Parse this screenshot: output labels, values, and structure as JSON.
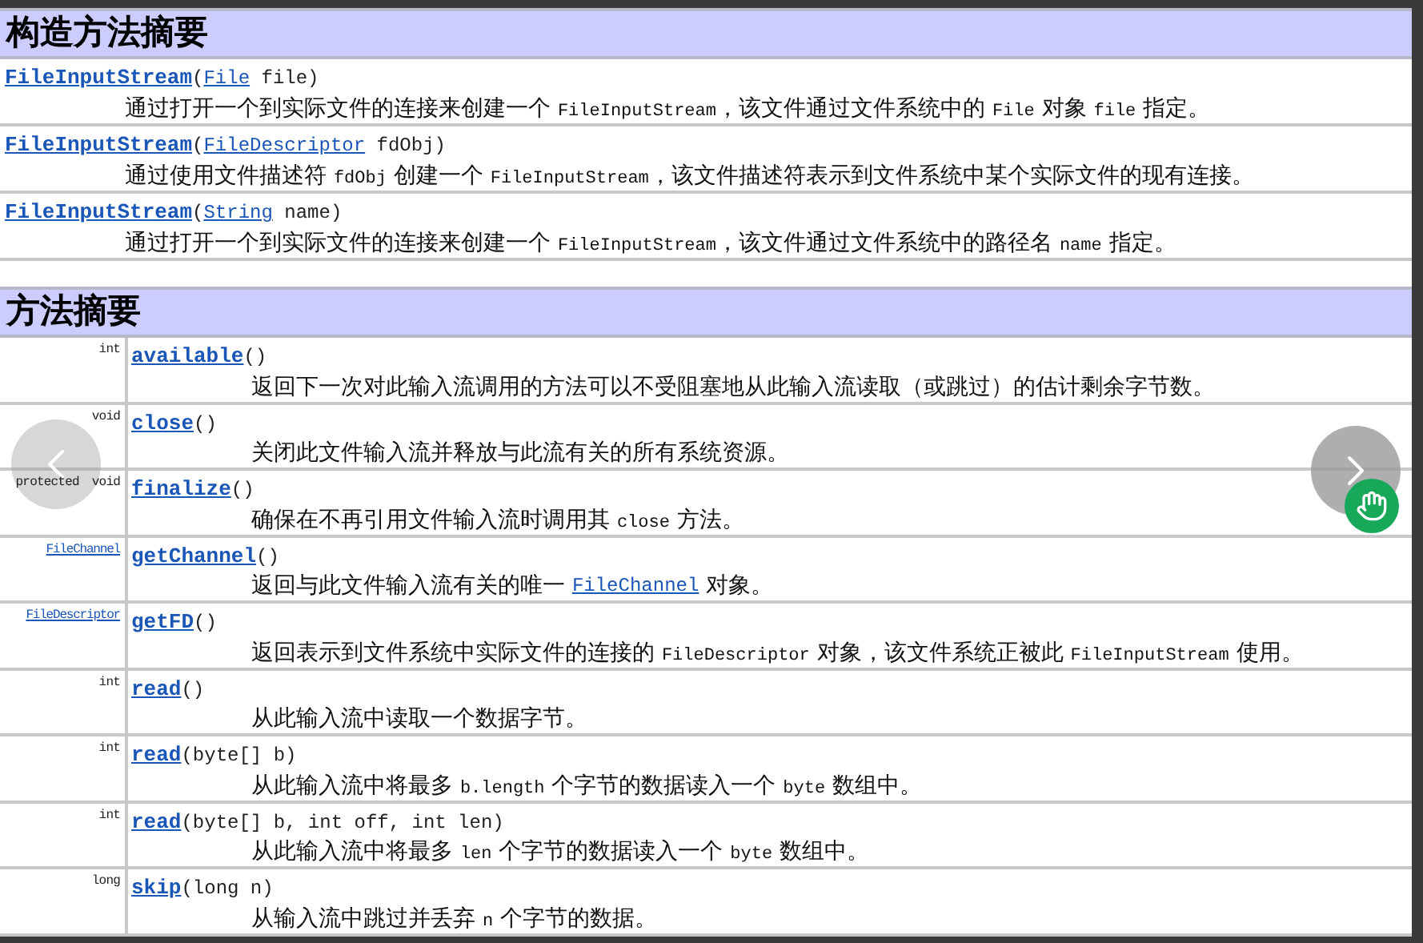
{
  "constructor_summary": {
    "title": "构造方法摘要",
    "rows": [
      {
        "signature": [
          {
            "kind": "method",
            "text": "FileInputStream"
          },
          {
            "kind": "plain",
            "text": "("
          },
          {
            "kind": "link",
            "text": "File"
          },
          {
            "kind": "plain",
            "text": " file)"
          }
        ],
        "description": [
          {
            "kind": "text",
            "text": "通过打开一个到实际文件的连接来创建一个 "
          },
          {
            "kind": "code",
            "text": "FileInputStream"
          },
          {
            "kind": "text",
            "text": "，该文件通过文件系统中的 "
          },
          {
            "kind": "code",
            "text": "File"
          },
          {
            "kind": "text",
            "text": " 对象 "
          },
          {
            "kind": "code",
            "text": "file"
          },
          {
            "kind": "text",
            "text": " 指定。"
          }
        ]
      },
      {
        "signature": [
          {
            "kind": "method",
            "text": "FileInputStream"
          },
          {
            "kind": "plain",
            "text": "("
          },
          {
            "kind": "link",
            "text": "FileDescriptor"
          },
          {
            "kind": "plain",
            "text": " fdObj)"
          }
        ],
        "description": [
          {
            "kind": "text",
            "text": "通过使用文件描述符 "
          },
          {
            "kind": "code",
            "text": "fdObj"
          },
          {
            "kind": "text",
            "text": " 创建一个 "
          },
          {
            "kind": "code",
            "text": "FileInputStream"
          },
          {
            "kind": "text",
            "text": "，该文件描述符表示到文件系统中某个实际文件的现有连接。"
          }
        ]
      },
      {
        "signature": [
          {
            "kind": "method",
            "text": "FileInputStream"
          },
          {
            "kind": "plain",
            "text": "("
          },
          {
            "kind": "link",
            "text": "String"
          },
          {
            "kind": "plain",
            "text": " name)"
          }
        ],
        "description": [
          {
            "kind": "text",
            "text": "通过打开一个到实际文件的连接来创建一个 "
          },
          {
            "kind": "code",
            "text": "FileInputStream"
          },
          {
            "kind": "text",
            "text": "，该文件通过文件系统中的路径名 "
          },
          {
            "kind": "code",
            "text": "name"
          },
          {
            "kind": "text",
            "text": " 指定。"
          }
        ]
      }
    ]
  },
  "method_summary": {
    "title": "方法摘要",
    "rows": [
      {
        "modifiers": [
          {
            "kind": "plain",
            "text": "int"
          }
        ],
        "signature": [
          {
            "kind": "method",
            "text": "available"
          },
          {
            "kind": "plain",
            "text": "()"
          }
        ],
        "description": [
          {
            "kind": "text",
            "text": "返回下一次对此输入流调用的方法可以不受阻塞地从此输入流读取（或跳过）的估计剩余字节数。"
          }
        ]
      },
      {
        "modifiers": [
          {
            "kind": "plain",
            "text": "void"
          }
        ],
        "signature": [
          {
            "kind": "method",
            "text": "close"
          },
          {
            "kind": "plain",
            "text": "()"
          }
        ],
        "description": [
          {
            "kind": "text",
            "text": "关闭此文件输入流并释放与此流有关的所有系统资源。"
          }
        ]
      },
      {
        "modifiers": [
          {
            "kind": "plain",
            "text": "protected"
          },
          {
            "kind": "plain",
            "text": "void"
          }
        ],
        "signature": [
          {
            "kind": "method",
            "text": "finalize"
          },
          {
            "kind": "plain",
            "text": "()"
          }
        ],
        "description": [
          {
            "kind": "text",
            "text": "确保在不再引用文件输入流时调用其 "
          },
          {
            "kind": "code",
            "text": "close"
          },
          {
            "kind": "text",
            "text": " 方法。"
          }
        ]
      },
      {
        "modifiers": [
          {
            "kind": "link",
            "text": "FileChannel"
          }
        ],
        "signature": [
          {
            "kind": "method",
            "text": "getChannel"
          },
          {
            "kind": "plain",
            "text": "()"
          }
        ],
        "description": [
          {
            "kind": "text",
            "text": "返回与此文件输入流有关的唯一 "
          },
          {
            "kind": "link",
            "text": "FileChannel"
          },
          {
            "kind": "text",
            "text": " 对象。"
          }
        ]
      },
      {
        "modifiers": [
          {
            "kind": "link",
            "text": "FileDescriptor"
          }
        ],
        "signature": [
          {
            "kind": "method",
            "text": "getFD"
          },
          {
            "kind": "plain",
            "text": "()"
          }
        ],
        "description": [
          {
            "kind": "text",
            "text": "返回表示到文件系统中实际文件的连接的 "
          },
          {
            "kind": "code",
            "text": "FileDescriptor"
          },
          {
            "kind": "text",
            "text": " 对象，该文件系统正被此 "
          },
          {
            "kind": "code",
            "text": "FileInputStream"
          },
          {
            "kind": "text",
            "text": " 使用。"
          }
        ]
      },
      {
        "modifiers": [
          {
            "kind": "plain",
            "text": "int"
          }
        ],
        "signature": [
          {
            "kind": "method",
            "text": "read"
          },
          {
            "kind": "plain",
            "text": "()"
          }
        ],
        "description": [
          {
            "kind": "text",
            "text": "从此输入流中读取一个数据字节。"
          }
        ]
      },
      {
        "modifiers": [
          {
            "kind": "plain",
            "text": "int"
          }
        ],
        "signature": [
          {
            "kind": "method",
            "text": "read"
          },
          {
            "kind": "plain",
            "text": "(byte[] b)"
          }
        ],
        "description": [
          {
            "kind": "text",
            "text": "从此输入流中将最多 "
          },
          {
            "kind": "code",
            "text": "b.length"
          },
          {
            "kind": "text",
            "text": " 个字节的数据读入一个 "
          },
          {
            "kind": "code",
            "text": "byte"
          },
          {
            "kind": "text",
            "text": " 数组中。"
          }
        ]
      },
      {
        "modifiers": [
          {
            "kind": "plain",
            "text": "int"
          }
        ],
        "signature": [
          {
            "kind": "method",
            "text": "read"
          },
          {
            "kind": "plain",
            "text": "(byte[] b, int off, int len)"
          }
        ],
        "description": [
          {
            "kind": "text",
            "text": "从此输入流中将最多 "
          },
          {
            "kind": "code",
            "text": "len"
          },
          {
            "kind": "text",
            "text": " 个字节的数据读入一个 "
          },
          {
            "kind": "code",
            "text": "byte"
          },
          {
            "kind": "text",
            "text": " 数组中。"
          }
        ]
      },
      {
        "modifiers": [
          {
            "kind": "plain",
            "text": "long"
          }
        ],
        "signature": [
          {
            "kind": "method",
            "text": "skip"
          },
          {
            "kind": "plain",
            "text": "(long n)"
          }
        ],
        "description": [
          {
            "kind": "text",
            "text": "从输入流中跳过并丢弃 "
          },
          {
            "kind": "code",
            "text": "n"
          },
          {
            "kind": "text",
            "text": " 个字节的数据。"
          }
        ]
      }
    ]
  }
}
